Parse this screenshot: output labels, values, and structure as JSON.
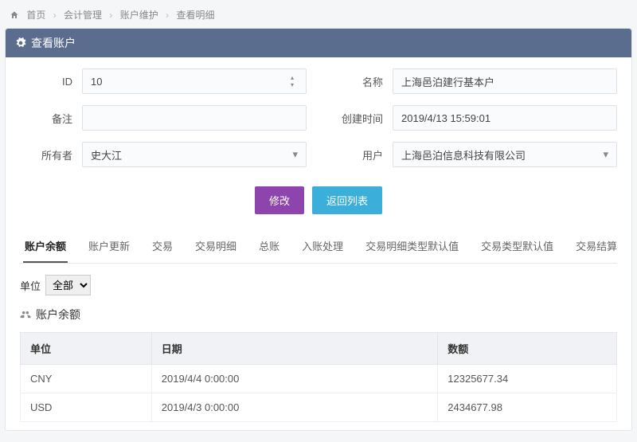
{
  "breadcrumb": {
    "home": "首页",
    "l1": "会计管理",
    "l2": "账户维护",
    "l3": "查看明细"
  },
  "panel": {
    "title": "查看账户"
  },
  "form": {
    "id_label": "ID",
    "id_value": "10",
    "name_label": "名称",
    "name_value": "上海邑泊建行基本户",
    "note_label": "备注",
    "note_value": "",
    "created_label": "创建时间",
    "created_value": "2019/4/13 15:59:01",
    "owner_label": "所有者",
    "owner_value": "史大江",
    "user_label": "用户",
    "user_value": "上海邑泊信息科技有限公司"
  },
  "buttons": {
    "edit": "修改",
    "back": "返回列表"
  },
  "tabs": [
    "账户余额",
    "账户更新",
    "交易",
    "交易明细",
    "总账",
    "入账处理",
    "交易明细类型默认值",
    "交易类型默认值",
    "交易结算"
  ],
  "active_tab": 0,
  "unit_filter": {
    "label": "单位",
    "selected": "全部"
  },
  "section": {
    "title": "账户余额"
  },
  "balance_table": {
    "headers": {
      "unit": "单位",
      "date": "日期",
      "amount": "数额"
    },
    "rows": [
      {
        "unit": "CNY",
        "date": "2019/4/4 0:00:00",
        "amount": "12325677.34"
      },
      {
        "unit": "USD",
        "date": "2019/4/3 0:00:00",
        "amount": "2434677.98"
      }
    ]
  }
}
